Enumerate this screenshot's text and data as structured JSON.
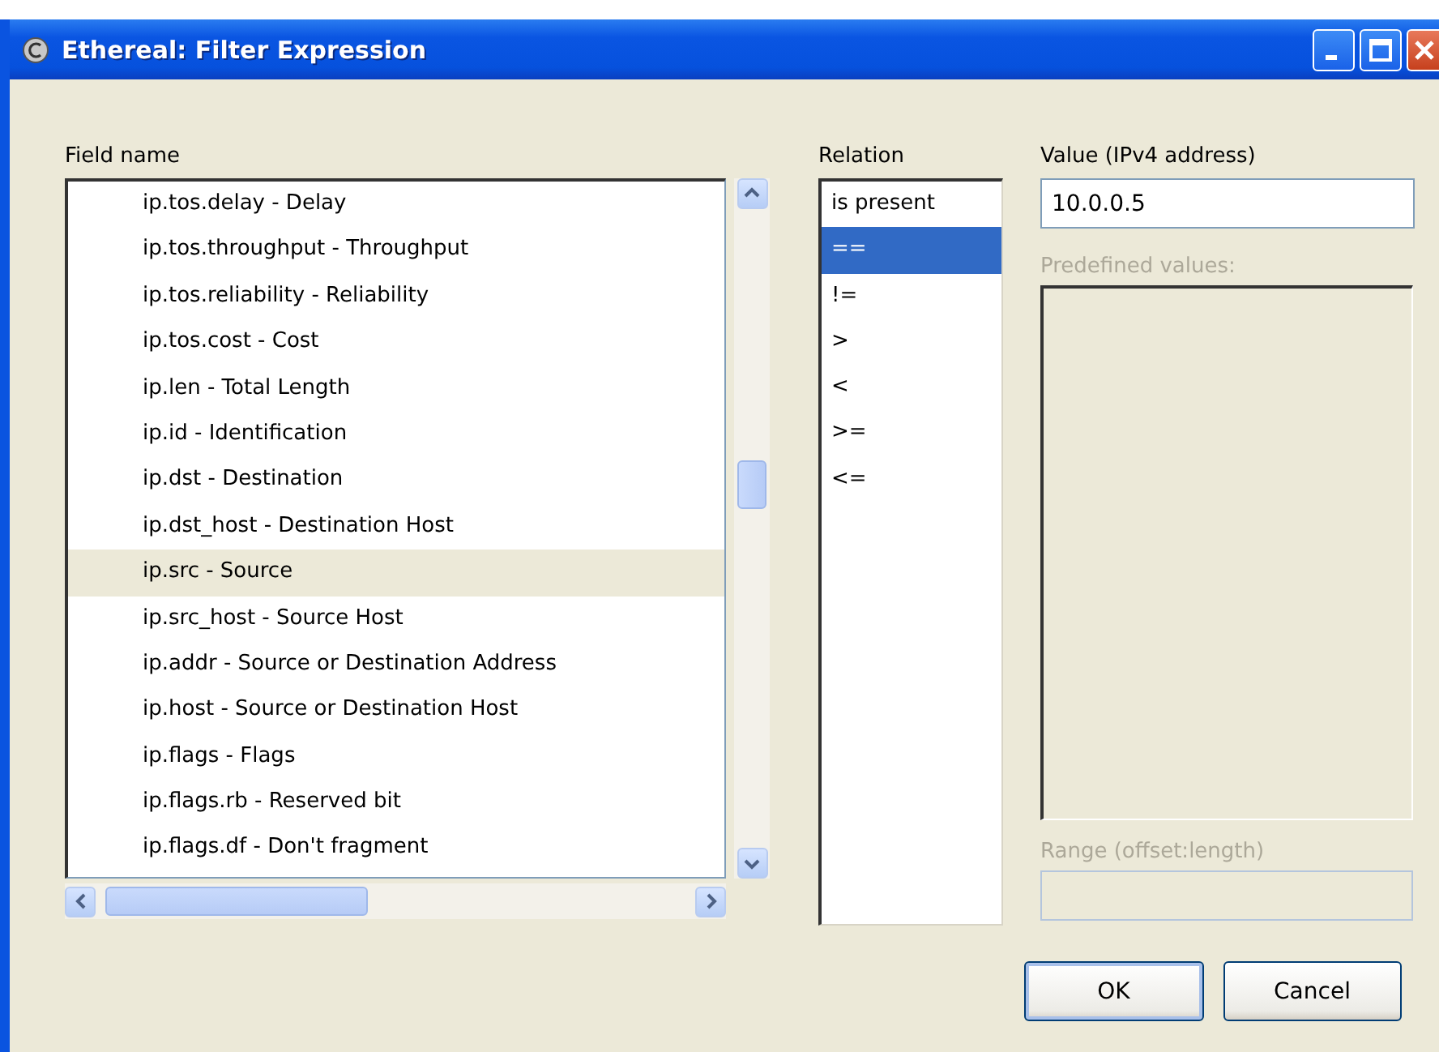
{
  "window": {
    "title": "Ethereal: Filter Expression"
  },
  "field_name": {
    "label": "Field name",
    "items": [
      {
        "label": "ip.tos.delay - Delay",
        "selected": false
      },
      {
        "label": "ip.tos.throughput - Throughput",
        "selected": false
      },
      {
        "label": "ip.tos.reliability - Reliability",
        "selected": false
      },
      {
        "label": "ip.tos.cost - Cost",
        "selected": false
      },
      {
        "label": "ip.len - Total Length",
        "selected": false
      },
      {
        "label": "ip.id - Identification",
        "selected": false
      },
      {
        "label": "ip.dst - Destination",
        "selected": false
      },
      {
        "label": "ip.dst_host - Destination Host",
        "selected": false
      },
      {
        "label": "ip.src - Source",
        "selected": true
      },
      {
        "label": "ip.src_host - Source Host",
        "selected": false
      },
      {
        "label": "ip.addr - Source or Destination Address",
        "selected": false
      },
      {
        "label": "ip.host - Source or Destination Host",
        "selected": false
      },
      {
        "label": "ip.flags - Flags",
        "selected": false
      },
      {
        "label": "ip.flags.rb - Reserved bit",
        "selected": false
      },
      {
        "label": "ip.flags.df - Don't fragment",
        "selected": false
      }
    ]
  },
  "relation": {
    "label": "Relation",
    "items": [
      {
        "label": "is present",
        "selected": false
      },
      {
        "label": "==",
        "selected": true
      },
      {
        "label": "!=",
        "selected": false
      },
      {
        "label": ">",
        "selected": false
      },
      {
        "label": "<",
        "selected": false
      },
      {
        "label": ">=",
        "selected": false
      },
      {
        "label": "<=",
        "selected": false
      }
    ]
  },
  "value": {
    "label": "Value (IPv4 address)",
    "value": "10.0.0.5"
  },
  "predefined": {
    "label": "Predefined values:",
    "disabled": true
  },
  "range": {
    "label": "Range (offset:length)",
    "disabled": true
  },
  "buttons": [
    {
      "label": "OK",
      "default": true
    },
    {
      "label": "Cancel",
      "default": false
    }
  ]
}
